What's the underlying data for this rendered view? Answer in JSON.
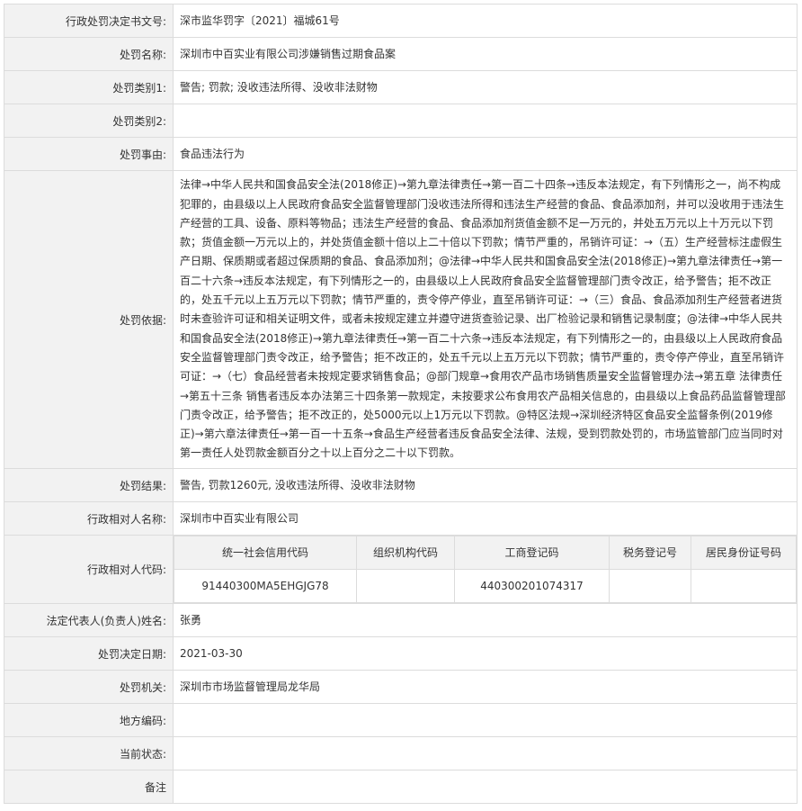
{
  "labels": {
    "decision_no": "行政处罚决定书文号:",
    "case_name": "处罚名称:",
    "category1": "处罚类别1:",
    "category2": "处罚类别2:",
    "reason": "处罚事由:",
    "basis": "处罚依据:",
    "result": "处罚结果:",
    "party_name": "行政相对人名称:",
    "party_code": "行政相对人代码:",
    "legal_rep": "法定代表人(负责人)姓名:",
    "decision_date": "处罚决定日期:",
    "authority": "处罚机关:",
    "region_code": "地方编码:",
    "status": "当前状态:",
    "remarks": "备注"
  },
  "values": {
    "decision_no": "深市监华罚字〔2021〕福城61号",
    "case_name": "深圳市中百实业有限公司涉嫌销售过期食品案",
    "category1": "警告; 罚款; 没收违法所得、没收非法财物",
    "category2": "",
    "reason": "食品违法行为",
    "basis": "法律→中华人民共和国食品安全法(2018修正)→第九章法律责任→第一百二十四条→违反本法规定，有下列情形之一，尚不构成犯罪的，由县级以上人民政府食品安全监督管理部门没收违法所得和违法生产经营的食品、食品添加剂，并可以没收用于违法生产经营的工具、设备、原料等物品；违法生产经营的食品、食品添加剂货值金额不足一万元的，并处五万元以上十万元以下罚款；货值金额一万元以上的，并处货值金额十倍以上二十倍以下罚款；情节严重的，吊销许可证：→（五）生产经营标注虚假生产日期、保质期或者超过保质期的食品、食品添加剂；@法律→中华人民共和国食品安全法(2018修正)→第九章法律责任→第一百二十六条→违反本法规定，有下列情形之一的，由县级以上人民政府食品安全监督管理部门责令改正，给予警告；拒不改正的，处五千元以上五万元以下罚款；情节严重的，责令停产停业，直至吊销许可证：→（三）食品、食品添加剂生产经营者进货时未查验许可证和相关证明文件，或者未按规定建立并遵守进货查验记录、出厂检验记录和销售记录制度；@法律→中华人民共和国食品安全法(2018修正)→第九章法律责任→第一百二十六条→违反本法规定，有下列情形之一的，由县级以上人民政府食品安全监督管理部门责令改正，给予警告；拒不改正的，处五千元以上五万元以下罚款；情节严重的，责令停产停业，直至吊销许可证：→（七）食品经营者未按规定要求销售食品；@部门规章→食用农产品市场销售质量安全监督管理办法→第五章 法律责任→第五十三条 销售者违反本办法第三十四条第一款规定，未按要求公布食用农产品相关信息的，由县级以上食品药品监督管理部门责令改正，给予警告；拒不改正的，处5000元以上1万元以下罚款。@特区法规→深圳经济特区食品安全监督条例(2019修正)→第六章法律责任→第一百一十五条→食品生产经营者违反食品安全法律、法规，受到罚款处罚的，市场监管部门应当同时对第一责任人处罚款金额百分之十以上百分之二十以下罚款。",
    "result": "警告, 罚款1260元, 没收违法所得、没收非法财物",
    "party_name": "深圳市中百实业有限公司",
    "legal_rep": "张勇",
    "decision_date": "2021-03-30",
    "authority": "深圳市市场监督管理局龙华局",
    "region_code": "",
    "status": "",
    "remarks": ""
  },
  "party_code": {
    "headers": [
      "统一社会信用代码",
      "组织机构代码",
      "工商登记码",
      "税务登记号",
      "居民身份证号码"
    ],
    "values": [
      "91440300MA5EHGJG78",
      "",
      "440300201074317",
      "",
      ""
    ]
  }
}
